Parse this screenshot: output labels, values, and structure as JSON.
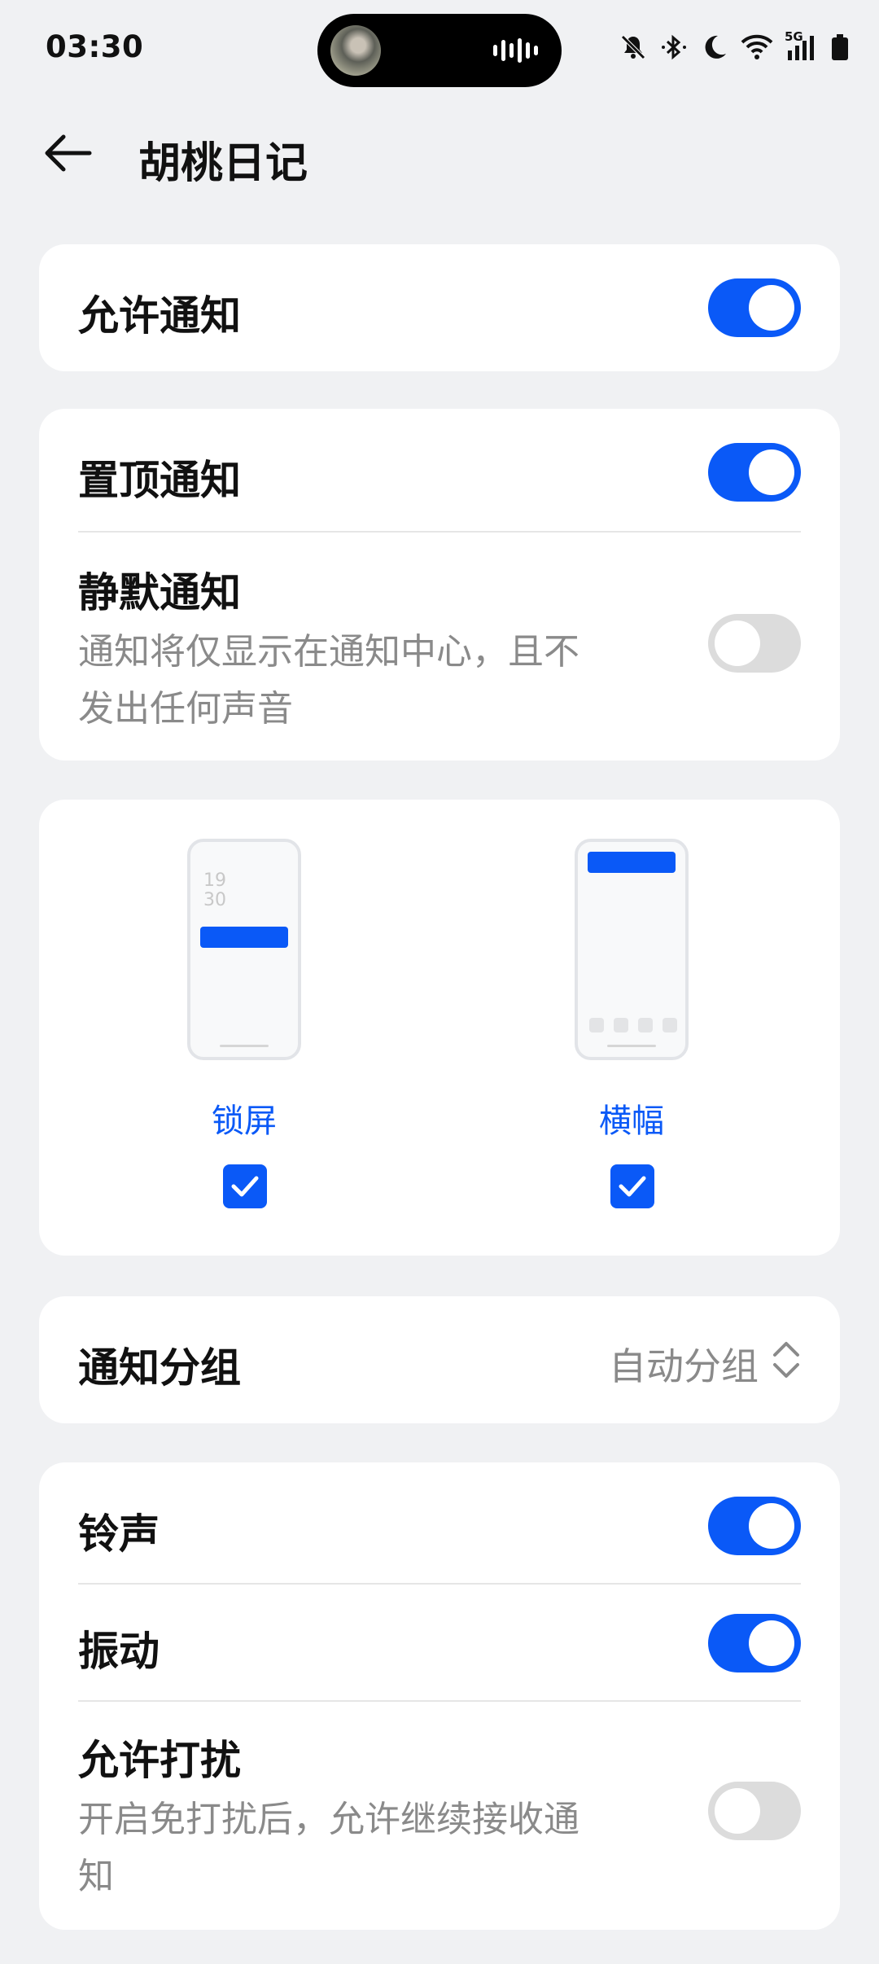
{
  "status_bar": {
    "time": "03:30",
    "icons": [
      "bell-off-icon",
      "bluetooth-icon",
      "moon-icon",
      "wifi-icon",
      "5g-signal-icon",
      "battery-icon"
    ],
    "network_label": "5G"
  },
  "header": {
    "title": "胡桃日记"
  },
  "allow_notifications": {
    "label": "允许通知",
    "enabled": true
  },
  "pinned": {
    "label": "置顶通知",
    "enabled": true
  },
  "silent": {
    "label": "静默通知",
    "desc_line1": "通知将仅显示在通知中心，且不",
    "desc_line2": "发出任何声音",
    "enabled": false
  },
  "previews": [
    {
      "label": "锁屏",
      "clock_h": "19",
      "clock_m": "30",
      "checked": true
    },
    {
      "label": "横幅",
      "checked": true
    }
  ],
  "grouping": {
    "label": "通知分组",
    "value": "自动分组"
  },
  "ringtone": {
    "label": "铃声",
    "enabled": true
  },
  "vibration": {
    "label": "振动",
    "enabled": true
  },
  "dnd": {
    "label": "允许打扰",
    "desc_line1": "开启免打扰后，允许继续接收通",
    "desc_line2": "知",
    "enabled": false
  },
  "colors": {
    "accent": "#0a59f7",
    "background": "#f0f1f3",
    "card": "#ffffff"
  }
}
